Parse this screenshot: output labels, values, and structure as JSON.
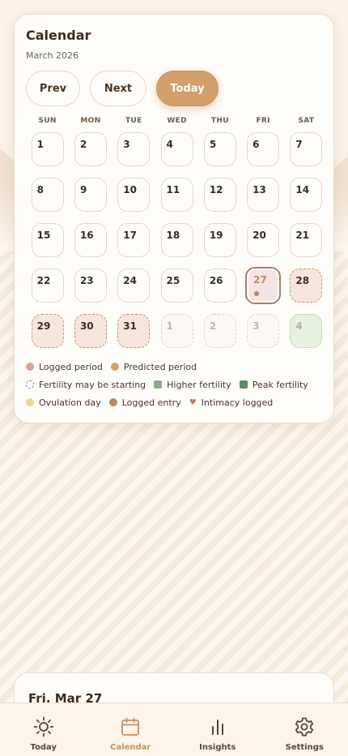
{
  "calendar": {
    "title": "Calendar",
    "month": "March 2026",
    "buttons": {
      "prev": "Prev",
      "next": "Next",
      "today": "Today"
    },
    "weekdays": [
      "SUN",
      "MON",
      "TUE",
      "WED",
      "THU",
      "FRI",
      "SAT"
    ],
    "days": [
      {
        "label": "1",
        "state": "normal"
      },
      {
        "label": "2",
        "state": "normal"
      },
      {
        "label": "3",
        "state": "normal"
      },
      {
        "label": "4",
        "state": "normal"
      },
      {
        "label": "5",
        "state": "normal"
      },
      {
        "label": "6",
        "state": "normal"
      },
      {
        "label": "7",
        "state": "normal"
      },
      {
        "label": "8",
        "state": "normal"
      },
      {
        "label": "9",
        "state": "normal"
      },
      {
        "label": "10",
        "state": "normal"
      },
      {
        "label": "11",
        "state": "normal"
      },
      {
        "label": "12",
        "state": "normal"
      },
      {
        "label": "13",
        "state": "normal"
      },
      {
        "label": "14",
        "state": "normal"
      },
      {
        "label": "15",
        "state": "normal"
      },
      {
        "label": "16",
        "state": "normal"
      },
      {
        "label": "17",
        "state": "normal"
      },
      {
        "label": "18",
        "state": "normal"
      },
      {
        "label": "19",
        "state": "normal"
      },
      {
        "label": "20",
        "state": "normal"
      },
      {
        "label": "21",
        "state": "normal"
      },
      {
        "label": "22",
        "state": "normal"
      },
      {
        "label": "23",
        "state": "normal"
      },
      {
        "label": "24",
        "state": "normal"
      },
      {
        "label": "25",
        "state": "normal"
      },
      {
        "label": "26",
        "state": "normal"
      },
      {
        "label": "27",
        "state": "today"
      },
      {
        "label": "28",
        "state": "predicted"
      },
      {
        "label": "29",
        "state": "predicted"
      },
      {
        "label": "30",
        "state": "predicted"
      },
      {
        "label": "31",
        "state": "predicted"
      },
      {
        "label": "1",
        "state": "faded"
      },
      {
        "label": "2",
        "state": "faded"
      },
      {
        "label": "3",
        "state": "faded"
      },
      {
        "label": "4",
        "state": "fertile"
      }
    ],
    "legend": [
      {
        "label": "Logged period",
        "kind": "logged"
      },
      {
        "label": "Predicted period",
        "kind": "predicted"
      },
      {
        "label": "Fertility may be starting",
        "kind": "maybe"
      },
      {
        "label": "Higher fertility",
        "kind": "higher"
      },
      {
        "label": "Peak fertility",
        "kind": "peak"
      },
      {
        "label": "Ovulation day",
        "kind": "ovulation"
      },
      {
        "label": "Logged entry",
        "kind": "entry"
      },
      {
        "label": "Intimacy logged",
        "kind": "heart"
      }
    ]
  },
  "detail": {
    "title": "Fri, Mar 27"
  },
  "tabs": [
    {
      "label": "Today",
      "icon": "sun-icon",
      "active": false
    },
    {
      "label": "Calendar",
      "icon": "calendar-icon",
      "active": true
    },
    {
      "label": "Insights",
      "icon": "bar-chart-icon",
      "active": false
    },
    {
      "label": "Settings",
      "icon": "gear-icon",
      "active": false
    }
  ],
  "colors": {
    "accent": "#d2a06a",
    "logged_period": "#d8a19a",
    "predicted_period": "#d6a165",
    "higher_fertility": "#8fa884",
    "peak_fertility": "#5b8b62",
    "ovulation": "#efd693",
    "logged_entry": "#bb885c"
  }
}
